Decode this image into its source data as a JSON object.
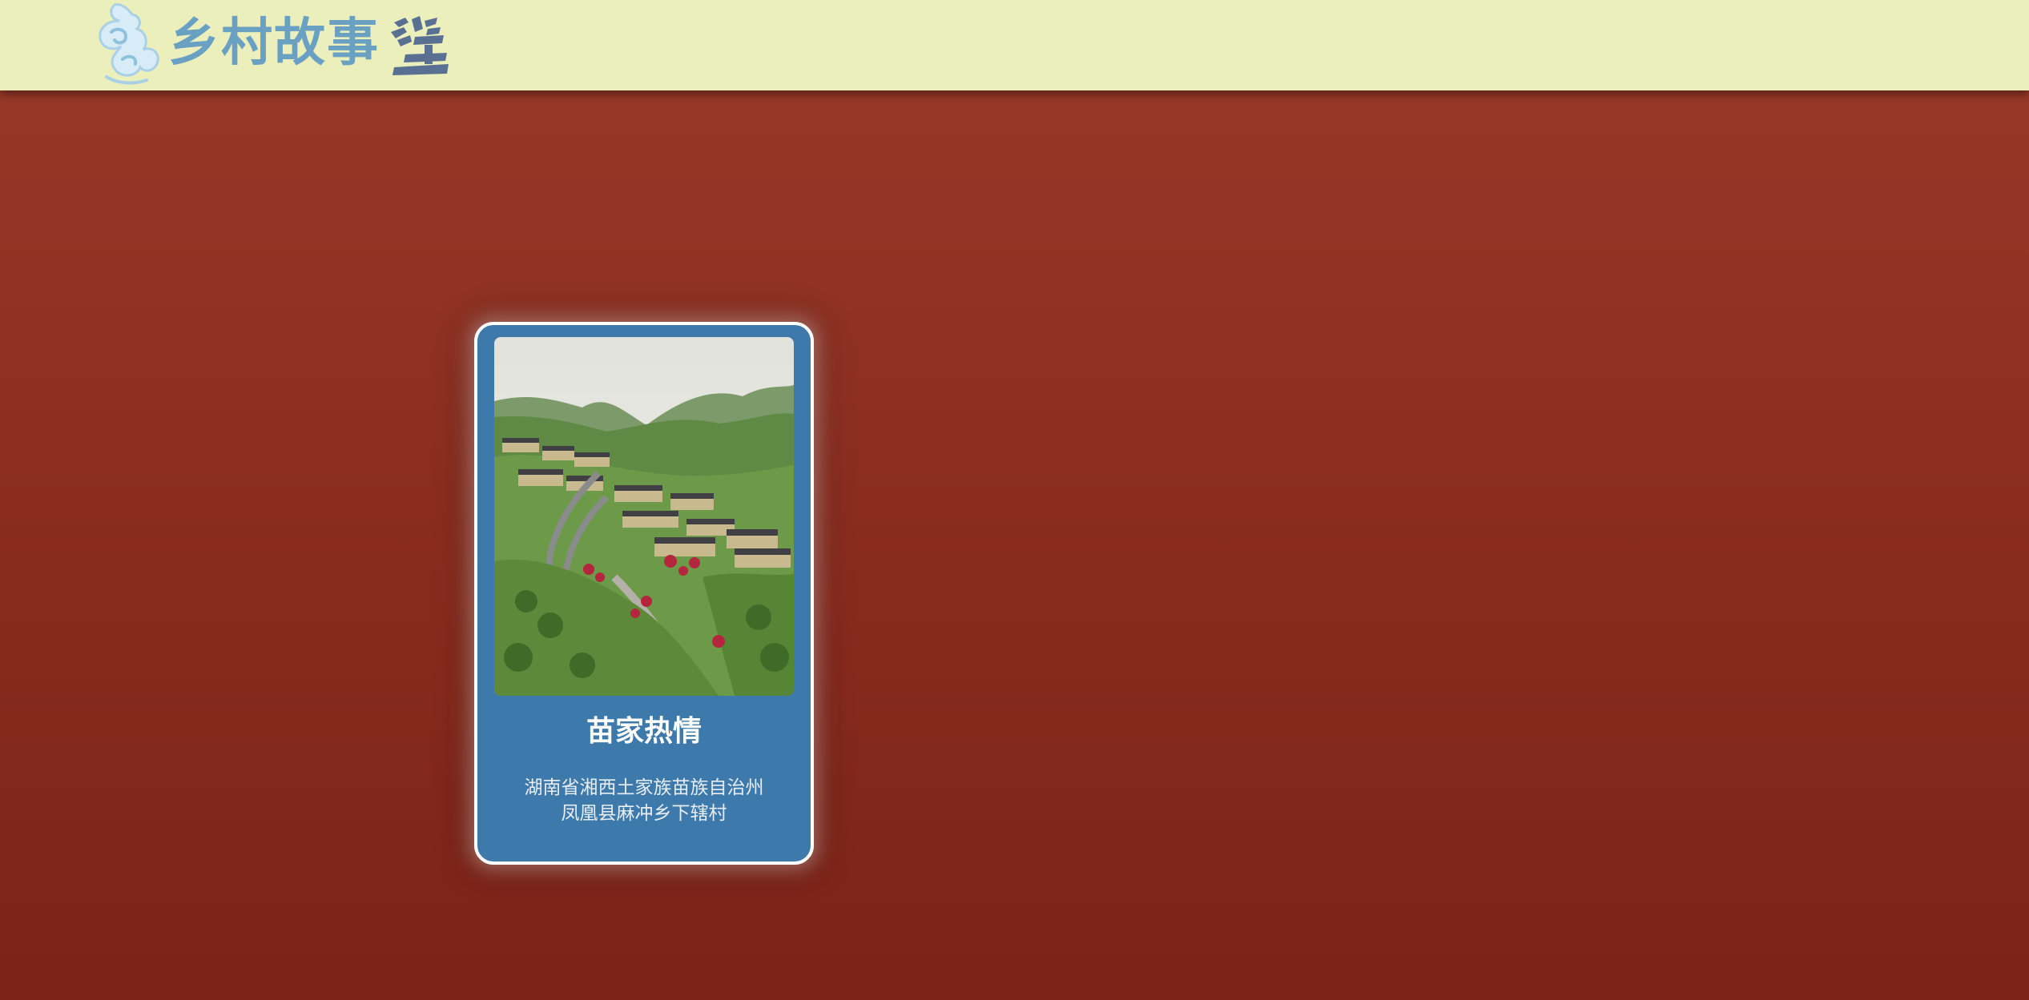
{
  "header": {
    "site_title": "乡村故事",
    "logo_icon": "cloud-swirl-icon",
    "seal_icon": "calligraphy-seal-icon",
    "background_color": "#ebefbc",
    "title_color": "#6aa0c2"
  },
  "page": {
    "background_color": "#8a2d20"
  },
  "cards": [
    {
      "title": "苗家热情",
      "address_line1": "湖南省湘西土家族苗族自治州",
      "address_line2": "凤凰县麻冲乡下辖村",
      "image_alt": "hillside-village-photo",
      "card_color": "#3e79ab"
    }
  ]
}
